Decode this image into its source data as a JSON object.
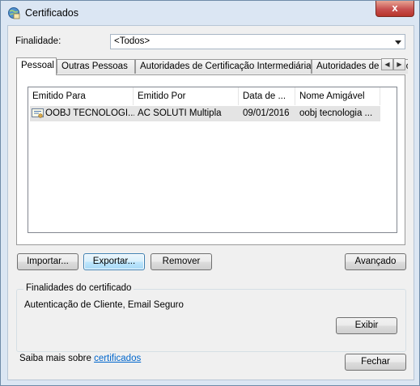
{
  "window": {
    "title": "Certificados",
    "close_label": "x"
  },
  "purpose": {
    "label": "Finalidade:",
    "selected": "<Todos>"
  },
  "tabs": [
    {
      "label": "Pessoal"
    },
    {
      "label": "Outras Pessoas"
    },
    {
      "label": "Autoridades de Certificação Intermediárias"
    },
    {
      "label": "Autoridades de Certificação"
    }
  ],
  "table": {
    "headers": [
      "Emitido Para",
      "Emitido Por",
      "Data de ...",
      "Nome Amigável"
    ],
    "rows": [
      {
        "issued_to": "OOBJ TECNOLOGI...",
        "issued_by": "AC SOLUTI Multipla",
        "date": "09/01/2016",
        "friendly_name": "oobj tecnologia ..."
      }
    ]
  },
  "buttons": {
    "import": "Importar...",
    "export": "Exportar...",
    "remove": "Remover",
    "advanced": "Avançado",
    "view": "Exibir",
    "close": "Fechar"
  },
  "purposes_group": {
    "title": "Finalidades do certificado",
    "text": "Autenticação de Cliente, Email Seguro"
  },
  "footer": {
    "learn_more": "Saiba mais sobre",
    "link": "certificados"
  }
}
